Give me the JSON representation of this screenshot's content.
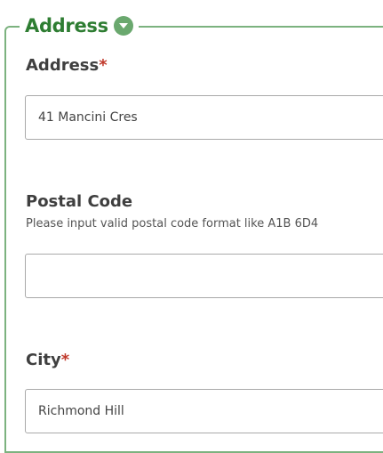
{
  "section": {
    "title": "Address"
  },
  "fields": {
    "address": {
      "label": "Address",
      "required_mark": "*",
      "value": "41 Mancini Cres"
    },
    "postal_code": {
      "label": "Postal Code",
      "hint": "Please input valid postal code format like A1B 6D4",
      "value": ""
    },
    "city": {
      "label": "City",
      "required_mark": "*",
      "value": "Richmond Hill"
    }
  },
  "colors": {
    "accent": "#2e7d32",
    "border": "#7cb27f",
    "required": "#c0392b"
  },
  "icons": {
    "toggle": "chevron-down-icon"
  }
}
